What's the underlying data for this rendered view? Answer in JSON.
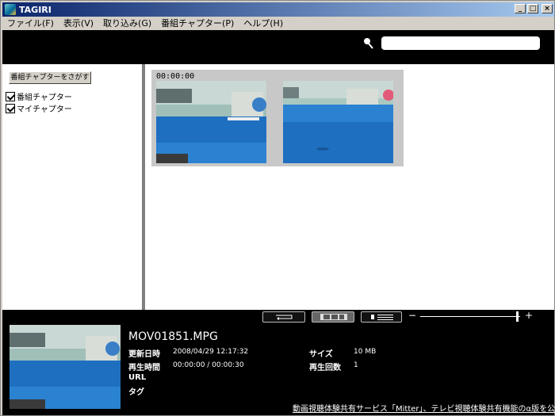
{
  "window": {
    "title": "TAGIRI",
    "buttons": [
      "_",
      "□",
      "×"
    ]
  },
  "menu": [
    {
      "label": "ファイル(F)"
    },
    {
      "label": "表示(V)"
    },
    {
      "label": "取り込み(G)"
    },
    {
      "label": "番組チャプター(P)"
    },
    {
      "label": "ヘルプ(H)"
    }
  ],
  "search": {
    "icon": "search-icon",
    "value": "",
    "placeholder": ""
  },
  "sidebar": {
    "find_button": "番組チャプターをさがす",
    "checks": [
      {
        "label": "番組チャプター",
        "checked": true
      },
      {
        "label": "マイチャプター",
        "checked": true
      }
    ]
  },
  "chapters": {
    "timecode": "00:00:00",
    "thumbnails": 2
  },
  "toolbar": {
    "buttons": [
      "return-icon",
      "filmstrip-icon",
      "list-icon"
    ],
    "zoom_minus": "−",
    "zoom_plus": "+",
    "zoom_level": 1.0
  },
  "details": {
    "filename": "MOV01851.MPG",
    "updated_label": "更新日時",
    "updated_value": "2008/04/29 12:17:32",
    "playtime_label": "再生時間",
    "playtime_value": "00:00:00 / 00:00:30",
    "url_label": "URL",
    "tag_label": "タグ",
    "size_label": "サイズ",
    "size_value": "10 MB",
    "playcount_label": "再生回数",
    "playcount_value": "1"
  },
  "promo": "動画視聴体験共有サービス「Mitter」、テレビ視聴体験共有機能のα版を公開",
  "colors": {
    "title_start": "#0a246a",
    "title_end": "#a6caf0",
    "pool": "#1f6fc0"
  }
}
